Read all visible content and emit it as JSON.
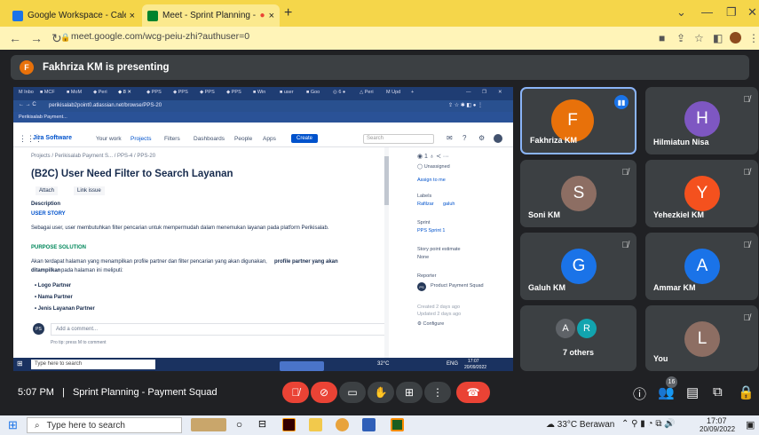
{
  "browser": {
    "tabs": [
      {
        "title": "Google Workspace - Calendar - J",
        "close": "×"
      },
      {
        "title": "Meet - Sprint Planning - Pay",
        "close": "×"
      }
    ],
    "new_tab": "+",
    "url": "meet.google.com/wcg-peiu-zhi?authuser=0"
  },
  "meet": {
    "presenting_banner": "Fakhriza KM is presenting",
    "presenter_initial": "F",
    "time": "5:07 PM",
    "separator": "|",
    "meeting_name": "Sprint Planning - Payment Squad",
    "people_count": "16"
  },
  "shared_screen": {
    "inner_url": "perikisalab2point0.atlassian.net/browse/PPS-20",
    "inner_crumb": "Perikisalab Payment...",
    "jira": {
      "logo": "Jira Software",
      "nav": [
        "Your work",
        "Projects",
        "Filters",
        "Dashboards",
        "People",
        "Apps"
      ],
      "create": "Create",
      "search": "Search",
      "breadcrumb": "Projects / Perikisalab Payment S... / PPS-4 / PPS-20",
      "title": "(B2C) User Need Filter to Search Layanan",
      "attach": "Attach",
      "link_issue": "Link issue",
      "description_label": "Description",
      "user_story": "USER STORY",
      "story_text": "Sebagai user, user membutuhkan filter pencarian untuk mempermudah dalam menemukan layanan pada platform Perikisalab.",
      "purpose": "PURPOSE SOLUTION",
      "purpose_text_a": "Akan terdapat halaman yang menampilkan profile partner dan filter pencarian yang akan digunakan,",
      "purpose_text_b": "profile partner yang akan",
      "purpose_text_c": "ditampilkan",
      "purpose_text_d": "pada halaman ini meliputi:",
      "bullets": [
        "Logo Partner",
        "Nama Partner",
        "Jenis Layanan Partner"
      ],
      "comment_initials": "PS",
      "comment_placeholder": "Add a comment...",
      "pro_tip": "Pro tip: press M to comment",
      "assignee": "Unassigned",
      "assign_to_me": "Assign to me",
      "labels_label": "Labels",
      "labels": [
        "Rafilzar",
        "galuh"
      ],
      "sprint_label": "Sprint",
      "sprint": "PPS Sprint 1",
      "estimate_label": "Story point estimate",
      "estimate": "None",
      "reporter_label": "Reporter",
      "reporter_initials": "PS",
      "reporter": "Product Payment Squad",
      "created": "Created 2 days ago",
      "updated": "Updated 2 days ago",
      "configure": "Configure"
    },
    "inner_taskbar_search": "Type here to search",
    "inner_temp": "32°C",
    "inner_lang": "ENG",
    "inner_time": "17:07",
    "inner_date": "20/09/2022"
  },
  "participants": [
    {
      "name": "Fakhriza KM",
      "initial": "F",
      "color": "#e8710a"
    },
    {
      "name": "Hilmiatun Nisa",
      "initial": "H",
      "color": "#7e57c2"
    },
    {
      "name": "Soni KM",
      "initial": "S",
      "color": "#8d6e63"
    },
    {
      "name": "Yehezkiel KM",
      "initial": "Y",
      "color": "#f4511e"
    },
    {
      "name": "Galuh KM",
      "initial": "G",
      "color": "#1a73e8"
    },
    {
      "name": "Ammar KM",
      "initial": "A",
      "color": "#1a73e8"
    },
    {
      "name": "7 others",
      "initials": [
        "A",
        "R"
      ]
    },
    {
      "name": "You",
      "initial": "L",
      "color": "#8d6e63"
    }
  ],
  "windows": {
    "search": "Type here to search",
    "weather": "33°C Berawan",
    "time": "17:07",
    "date": "20/09/2022"
  },
  "colors": {
    "meet_bg": "#202124",
    "tile_bg": "#3c4043",
    "end_call": "#ea4335",
    "jira_blue": "#0052cc",
    "browser_tab": "#f5d64a"
  }
}
